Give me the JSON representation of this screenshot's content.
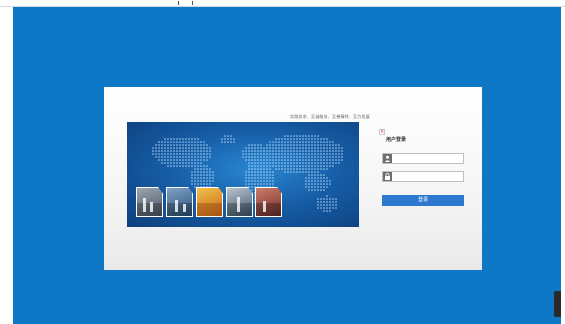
{
  "portal": {
    "slogan": "实践务求、至诚服务、至善臻特、至力发展",
    "login_title": "用户登录",
    "login_button": "登录",
    "username": {
      "value": "",
      "placeholder": ""
    },
    "password": {
      "value": "",
      "placeholder": ""
    },
    "close_glyph": "×"
  },
  "icons": [
    "user-icon",
    "lock-icon",
    "close-icon",
    "world-map"
  ],
  "colors": {
    "desktop": "#0f78c6",
    "button": "#2e78cf",
    "banner": "#175fa8"
  }
}
